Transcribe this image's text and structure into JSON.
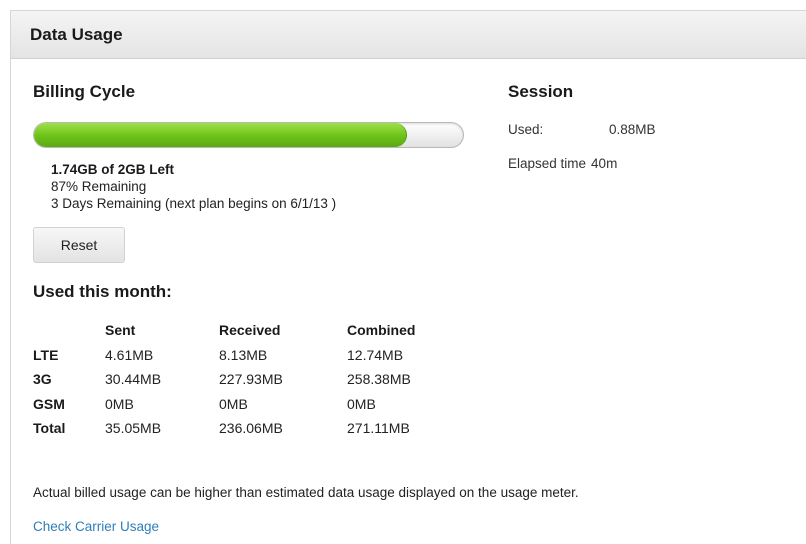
{
  "panel": {
    "title": "Data Usage"
  },
  "billing_cycle": {
    "heading": "Billing Cycle",
    "progress_fraction": 0.87,
    "left_text": "1.74GB of 2GB Left",
    "percent_text": "87% Remaining",
    "days_text": "3 Days Remaining (next plan begins on 6/1/13 )",
    "reset_label": "Reset"
  },
  "session": {
    "heading": "Session",
    "used_label": "Used:",
    "used_value": "0.88MB",
    "elapsed_label": "Elapsed time",
    "elapsed_value": "40m"
  },
  "monthly": {
    "heading": "Used this month:",
    "columns": [
      "",
      "Sent",
      "Received",
      "Combined"
    ],
    "rows": [
      {
        "label": "LTE",
        "sent": "4.61MB",
        "received": "8.13MB",
        "combined": "12.74MB"
      },
      {
        "label": "3G",
        "sent": "30.44MB",
        "received": "227.93MB",
        "combined": "258.38MB"
      },
      {
        "label": "GSM",
        "sent": "0MB",
        "received": "0MB",
        "combined": "0MB"
      },
      {
        "label": "Total",
        "sent": "35.05MB",
        "received": "236.06MB",
        "combined": "271.11MB"
      }
    ]
  },
  "footer": {
    "disclaimer": "Actual billed usage can be higher than estimated data usage displayed on the usage meter.",
    "link_label": "Check Carrier Usage"
  },
  "colors": {
    "progress_fill": "#6cc218",
    "link": "#2e7fb8",
    "header_bg": "#e9e9e9"
  }
}
